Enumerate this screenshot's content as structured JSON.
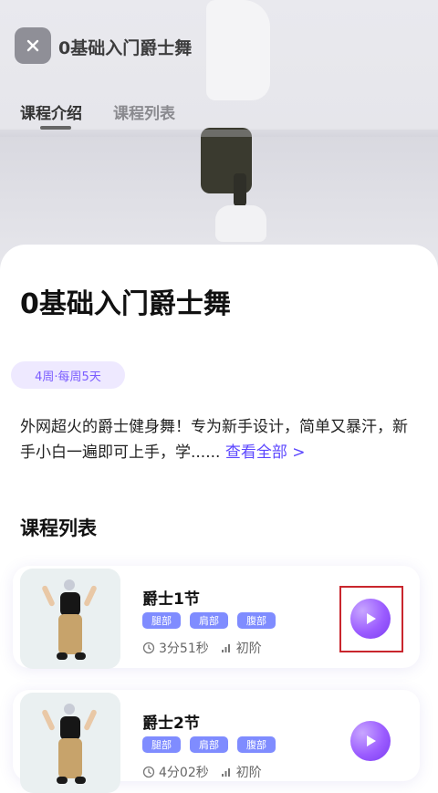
{
  "header": {
    "title": "0基础入门爵士舞",
    "tabs": [
      {
        "label": "课程介绍",
        "active": true
      },
      {
        "label": "课程列表",
        "active": false
      }
    ]
  },
  "course": {
    "title": "0基础入门爵士舞",
    "schedule_badge": "4周·每周5天",
    "description": "外网超火的爵士健身舞！专为新手设计，简单又暴汗，新手小白一遍即可上手，学......",
    "see_all": "查看全部 >"
  },
  "list": {
    "heading": "课程列表",
    "items": [
      {
        "title": "爵士1节",
        "tags": [
          "腿部",
          "肩部",
          "腹部"
        ],
        "duration": "3分51秒",
        "level": "初阶"
      },
      {
        "title": "爵士2节",
        "tags": [
          "腿部",
          "肩部",
          "腹部"
        ],
        "duration": "4分02秒",
        "level": "初阶"
      }
    ]
  },
  "colors": {
    "accent": "#5b46ff",
    "badge_bg": "#eee9ff",
    "tag_bg": "#7f8cff",
    "play_gradient_center": "#9b5cff",
    "highlight": "#c9262d"
  },
  "icons": {
    "close": "close-icon",
    "play": "play-icon",
    "clock": "clock-icon",
    "level": "signal-bars-icon"
  }
}
